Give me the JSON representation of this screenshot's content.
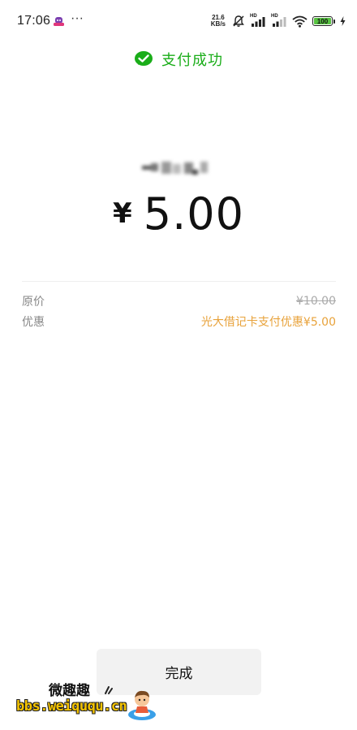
{
  "status_bar": {
    "time": "17:06",
    "more_dots": "···",
    "net_speed_value": "21.6",
    "net_speed_unit": "KB/s",
    "signal_label_1": "HD",
    "signal_label_2": "HD",
    "battery_level": "100",
    "icons": [
      "app-notification-icon",
      "mute-bell-icon",
      "signal-hd-icon",
      "signal-hd-icon",
      "wifi-icon",
      "battery-icon",
      "charging-icon"
    ]
  },
  "header": {
    "title": "支付成功",
    "icon": "wechat-pay-check-icon",
    "accent_color": "#1aad19"
  },
  "payment": {
    "currency": "¥",
    "amount": "5.00"
  },
  "details": {
    "original_label": "原价",
    "original_value": "¥10.00",
    "discount_label": "优惠",
    "discount_value": "光大借记卡支付优惠¥5.00",
    "discount_color": "#e8a23a"
  },
  "actions": {
    "done_label": "完成"
  },
  "watermark": {
    "line1": "微趣趣",
    "line2": "bbs.weiququ.cn"
  }
}
